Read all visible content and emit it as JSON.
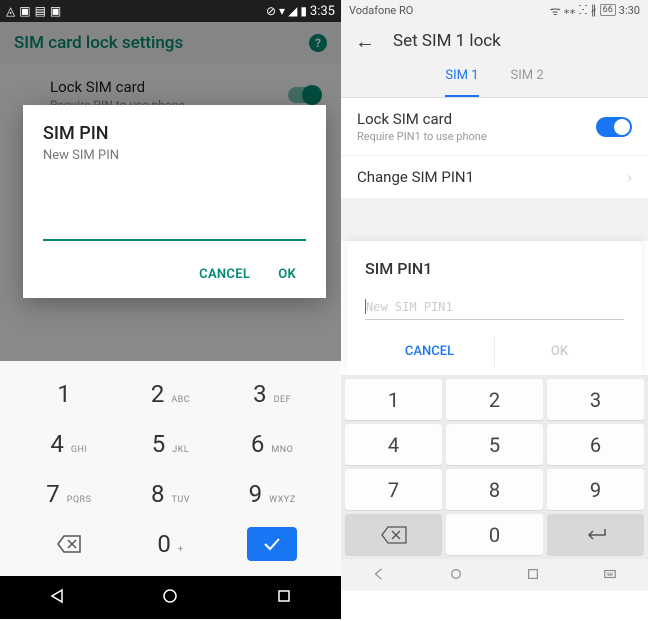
{
  "left": {
    "status": {
      "time": "3:35"
    },
    "header": {
      "title": "SIM card lock settings"
    },
    "setting": {
      "title": "Lock SIM card",
      "subtitle": "Require PIN to use phone"
    },
    "dialog": {
      "title": "SIM PIN",
      "subtitle": "New SIM PIN",
      "cancel": "CANCEL",
      "ok": "OK"
    },
    "keypad": {
      "k1": "1",
      "k2": "2",
      "k3": "3",
      "k4": "4",
      "k5": "5",
      "k6": "6",
      "k7": "7",
      "k8": "8",
      "k9": "9",
      "k0": "0",
      "l2": "ABC",
      "l3": "DEF",
      "l4": "GHI",
      "l5": "JKL",
      "l6": "MNO",
      "l7": "PQRS",
      "l8": "TUV",
      "l9": "WXYZ",
      "l0": "+"
    }
  },
  "right": {
    "status": {
      "carrier": "Vodafone RO",
      "battery": "66",
      "time": "3:30"
    },
    "header": {
      "title": "Set SIM 1 lock"
    },
    "tabs": {
      "t1": "SIM 1",
      "t2": "SIM 2"
    },
    "row1": {
      "title": "Lock SIM card",
      "subtitle": "Require PIN1 to use phone"
    },
    "row2": {
      "title": "Change SIM PIN1"
    },
    "dialog": {
      "title": "SIM PIN1",
      "placeholder": "New SIM PIN1",
      "cancel": "CANCEL",
      "ok": "OK"
    },
    "keypad": {
      "k1": "1",
      "k2": "2",
      "k3": "3",
      "k4": "4",
      "k5": "5",
      "k6": "6",
      "k7": "7",
      "k8": "8",
      "k9": "9",
      "k0": "0",
      "dot": "."
    }
  }
}
